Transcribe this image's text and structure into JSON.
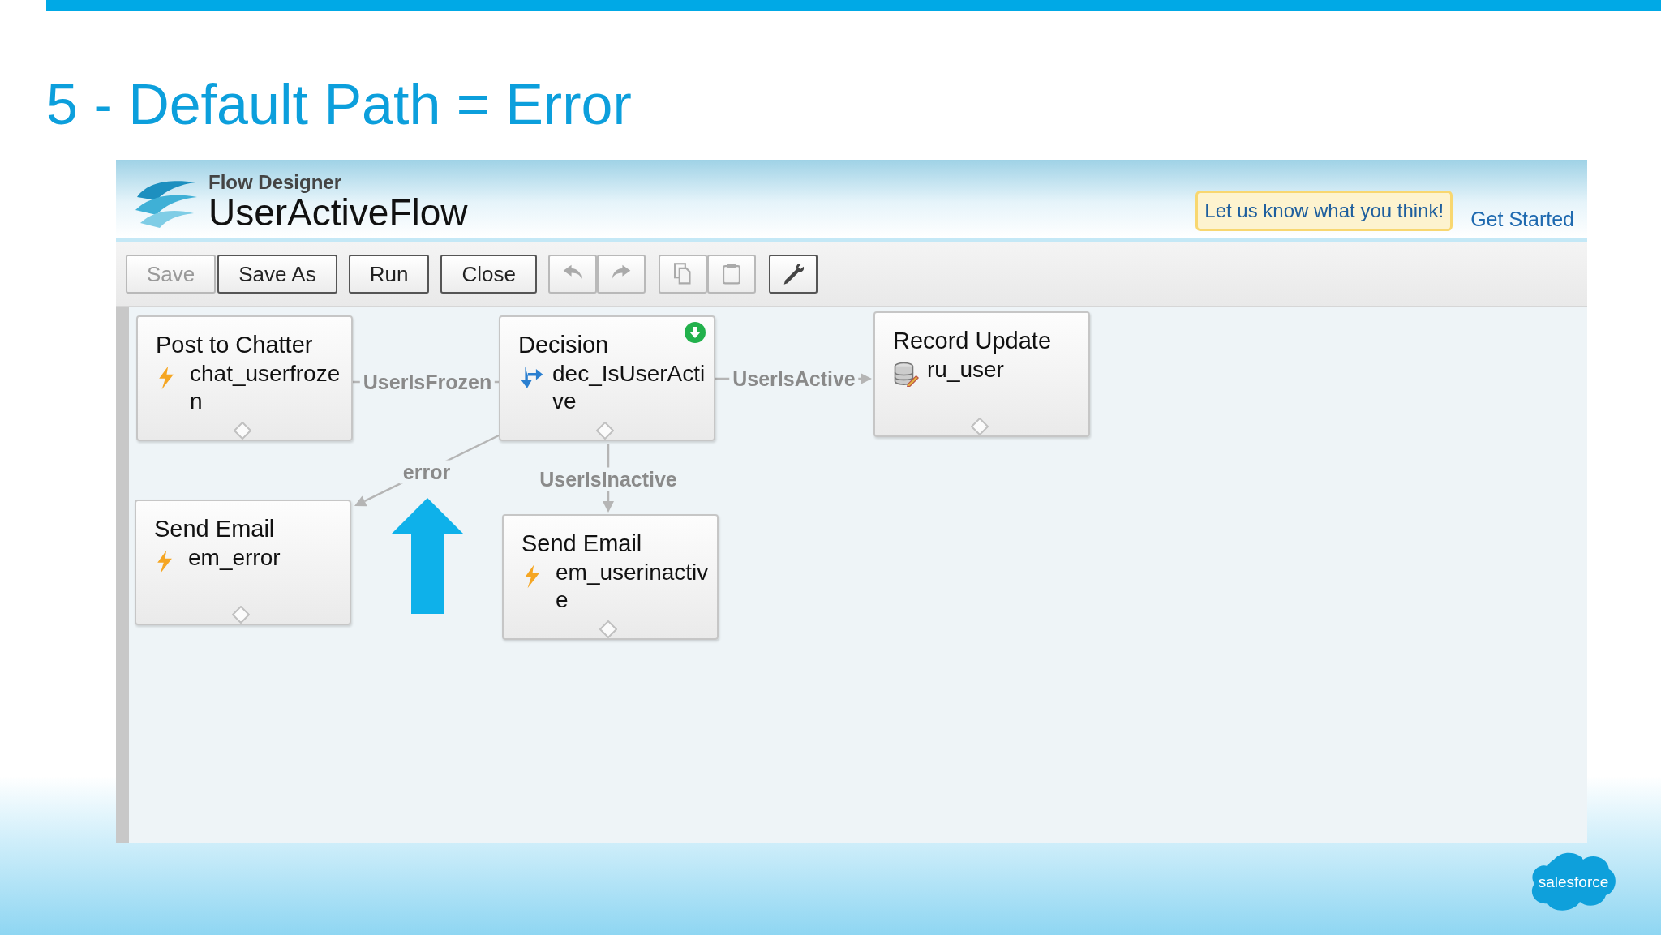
{
  "slide": {
    "title": "5 - Default Path = Error",
    "logo": "salesforce"
  },
  "app": {
    "product": "Flow Designer",
    "flow_name": "UserActiveFlow",
    "feedback_button": "Let us know what you think!",
    "get_started_link": "Get Started"
  },
  "toolbar": [
    {
      "kind": "text",
      "label": "Save",
      "disabled": true
    },
    {
      "kind": "text",
      "label": "Save As",
      "disabled": false
    },
    {
      "kind": "text",
      "label": "Run",
      "disabled": false
    },
    {
      "kind": "text",
      "label": "Close",
      "disabled": false
    },
    {
      "kind": "undo",
      "disabled": true
    },
    {
      "kind": "redo",
      "disabled": true
    },
    {
      "kind": "copy",
      "disabled": true
    },
    {
      "kind": "paste",
      "disabled": true
    },
    {
      "kind": "wrench",
      "disabled": false
    }
  ],
  "canvas": {
    "nodes": [
      {
        "kind": "action",
        "title": "Post to Chatter",
        "name": "chat_userfrozen",
        "start": false
      },
      {
        "kind": "decision",
        "title": "Decision",
        "name": "dec_IsUserActive",
        "start": true
      },
      {
        "kind": "record_update",
        "title": "Record Update",
        "name": "ru_user",
        "start": false
      },
      {
        "kind": "action",
        "title": "Send Email",
        "name": "em_error",
        "start": false
      },
      {
        "kind": "action",
        "title": "Send Email",
        "name": "em_userinactive",
        "start": false
      }
    ],
    "connectors": [
      {
        "label": "UserIsFrozen",
        "arrowhead": false
      },
      {
        "label": "UserIsActive",
        "arrowhead": true
      },
      {
        "label": "error",
        "arrowhead": true
      },
      {
        "label": "UserIsInactive",
        "arrowhead": true
      }
    ],
    "callout_arrow": true
  }
}
